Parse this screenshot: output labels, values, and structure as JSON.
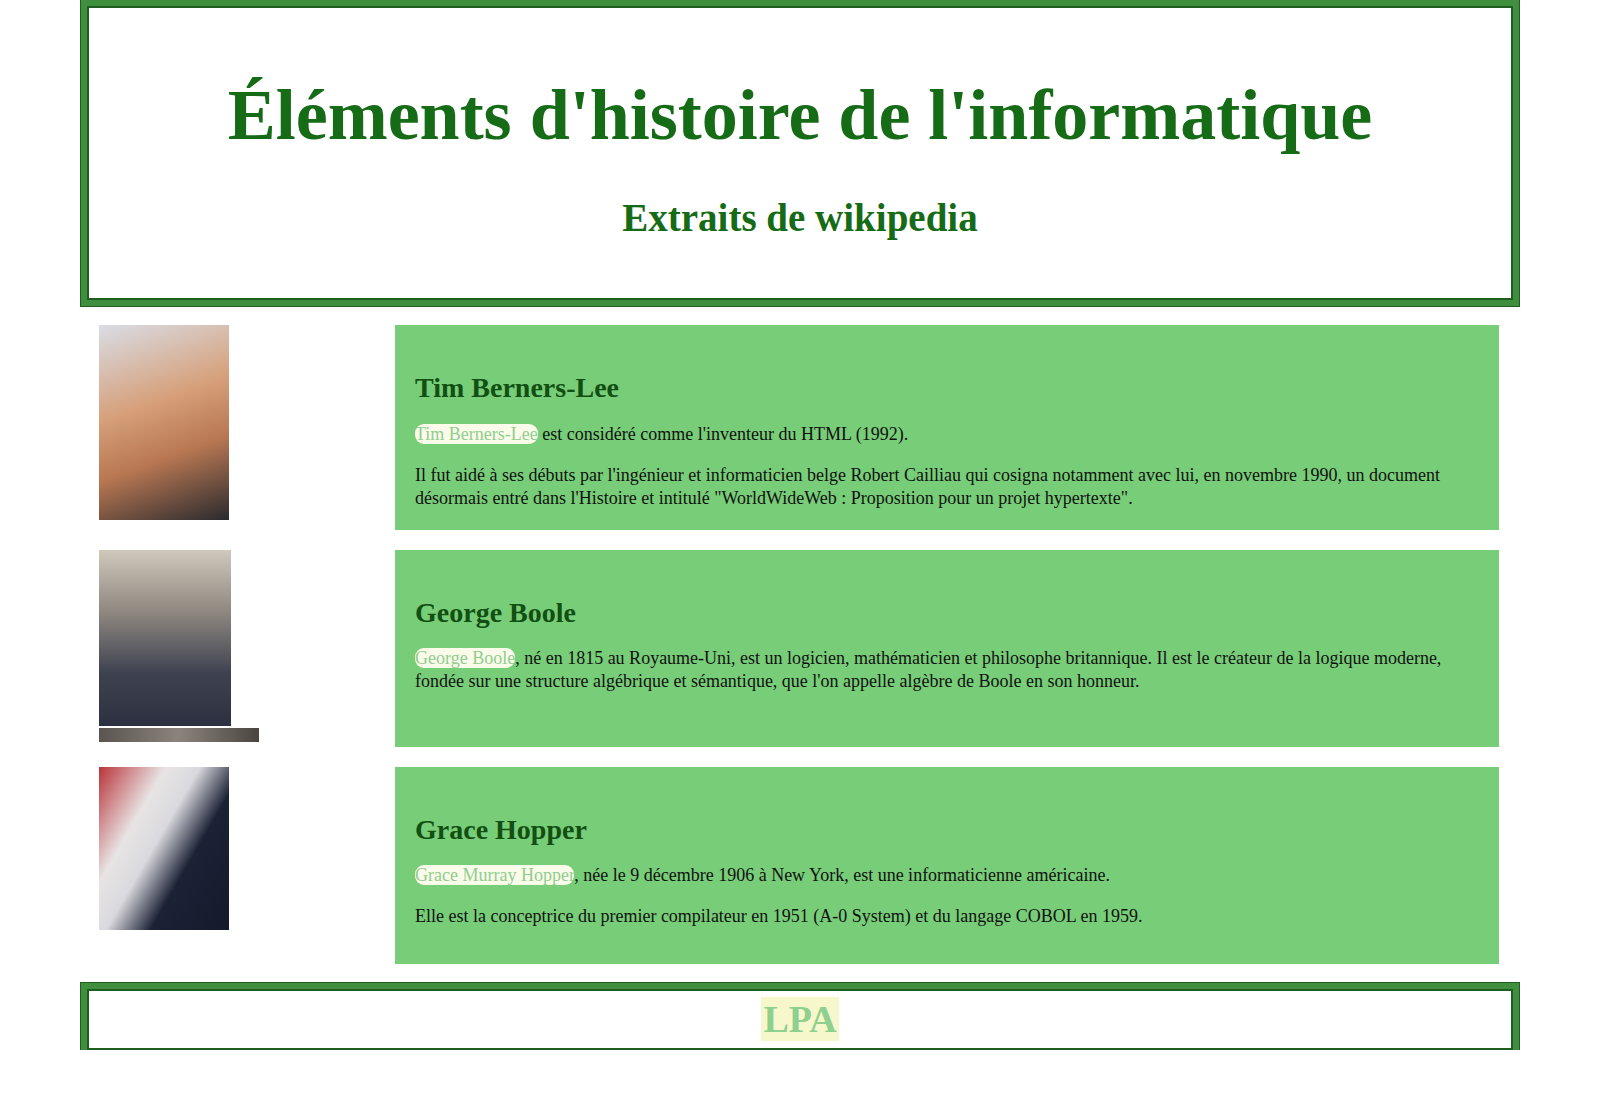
{
  "header": {
    "title": "Éléments d'histoire de l'informatique",
    "subtitle": "Extraits de wikipedia"
  },
  "entries": [
    {
      "heading": "Tim Berners-Lee",
      "link": "Tim Berners-Lee",
      "intro": " est considéré comme l'inventeur du HTML (1992).",
      "paragraphs": [
        "Il fut aidé à ses débuts par l'ingénieur et informaticien belge Robert Cailliau qui cosigna notamment avec lui, en novembre 1990, un document désormais entré dans l'Histoire et intitulé \"WorldWideWeb : Proposition pour un projet hypertexte\"."
      ]
    },
    {
      "heading": "George Boole",
      "link": "George Boole",
      "intro": ", né en 1815 au Royaume-Uni, est un logicien, mathématicien et philosophe britannique. Il est le créateur de la logique moderne, fondée sur une structure algébrique et sémantique, que l'on appelle algèbre de Boole en son honneur.",
      "paragraphs": []
    },
    {
      "heading": "Grace Hopper",
      "link": "Grace Murray Hopper",
      "intro": ", née le 9 décembre 1906 à New York, est une informaticienne américaine.",
      "paragraphs": [
        "Elle est la conceptrice du premier compilateur en 1951 (A-0 System) et du langage COBOL en 1959."
      ]
    }
  ],
  "footer": {
    "text": "LPA"
  }
}
